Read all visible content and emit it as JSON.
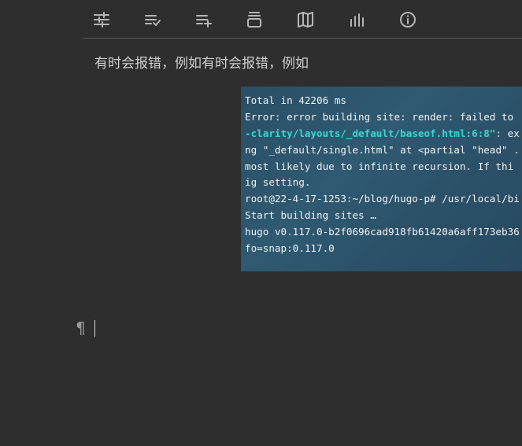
{
  "toolbar": {
    "icons": [
      "sliders-icon",
      "list-check-icon",
      "playlist-add-icon",
      "stack-icon",
      "map-book-icon",
      "bar-chart-icon",
      "info-icon"
    ]
  },
  "editor": {
    "paragraph": "有时会报错，例如有时会报错，例如",
    "pilcrow": "¶"
  },
  "terminal": {
    "line1": "Total in 42206 ms",
    "line2": "Error: error building site: render: failed to",
    "line3_cyan": "-clarity/layouts/_default/baseof.html:6:8\"",
    "line3_rest": ": ex",
    "line4": "ng \"_default/single.html\" at <partial \"head\" .",
    "line5": " most likely due to infinite recursion. If thi",
    "line6": "ig setting.",
    "line7": "root@22-4-17-1253:~/blog/hugo-p# /usr/local/bi",
    "line8": "Start building sites …",
    "line9": "hugo v0.117.0-b2f0696cad918fb61420a6aff173eb36",
    "line10": "fo=snap:0.117.0"
  }
}
